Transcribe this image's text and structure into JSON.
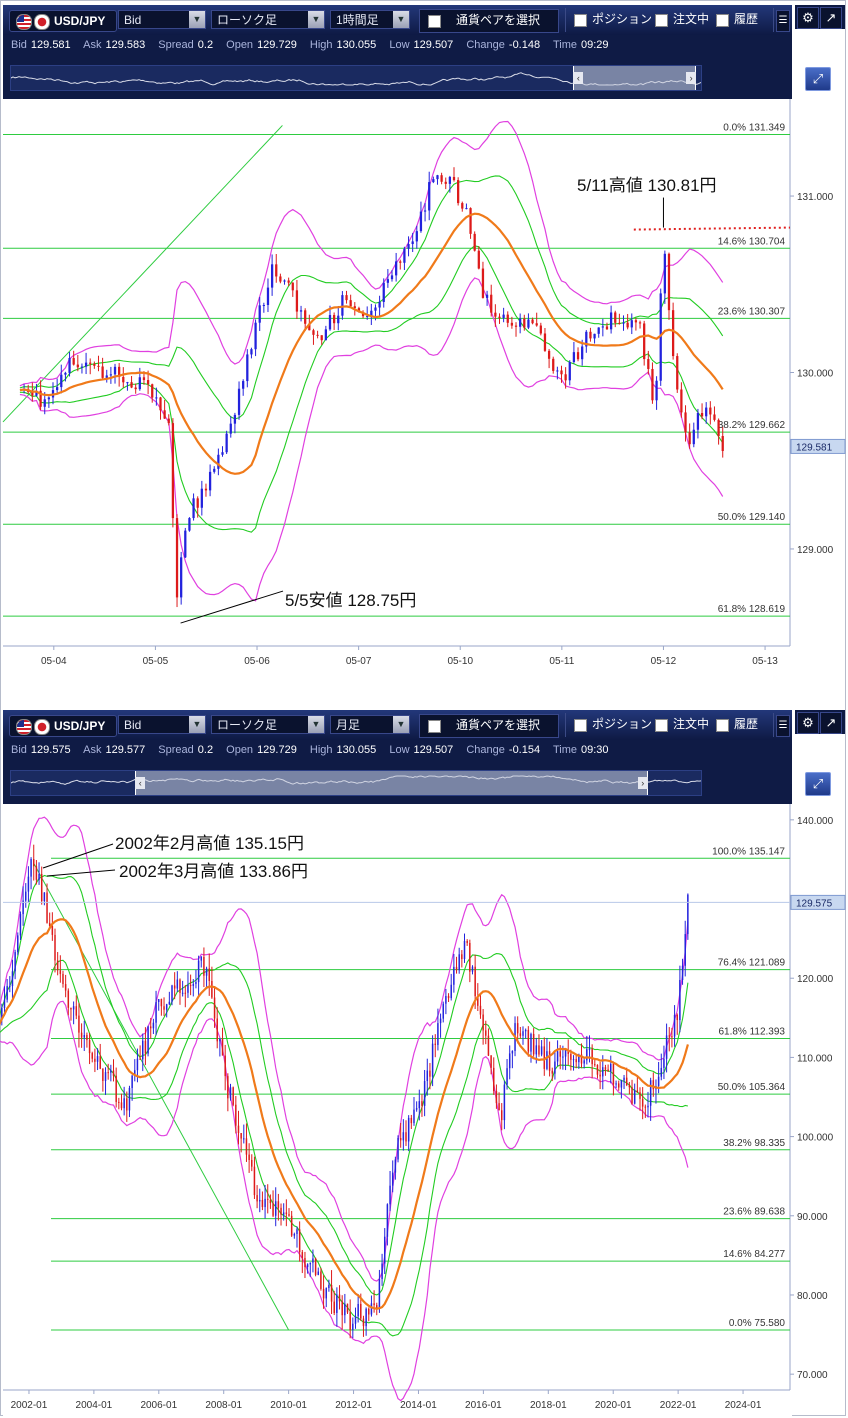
{
  "panels": [
    {
      "toolbar": {
        "pair": "USD/JPY",
        "price_type": "Bid",
        "chart_type": "ローソク足",
        "timeframe": "1時間足",
        "pair_select": "通貨ペアを選択",
        "position": "ポジション",
        "orders": "注文中",
        "history": "履歴"
      },
      "quote": {
        "bid_label": "Bid",
        "bid": "129.581",
        "ask_label": "Ask",
        "ask": "129.583",
        "spread_label": "Spread",
        "spread": "0.2",
        "open_label": "Open",
        "open": "129.729",
        "high_label": "High",
        "high": "130.055",
        "low_label": "Low",
        "low": "129.507",
        "change_label": "Change",
        "change": "-0.148",
        "time_label": "Time",
        "time": "09:29"
      },
      "navigator": {
        "selection_start": 0.815,
        "selection_end": 0.99
      },
      "annotations": [
        "5/11高値 130.81円",
        "5/5安値 128.75円"
      ],
      "current_price": "129.581",
      "fib_labels": [
        "0.0%  131.349",
        "14.6%  130.704",
        "23.6%  130.307",
        "38.2%  129.662",
        "50.0%  129.140",
        "61.8%  128.619"
      ],
      "y_ticks": [
        "131.000",
        "130.000",
        "129.000"
      ],
      "x_ticks": [
        "05-04",
        "05-05",
        "05-06",
        "05-07",
        "05-10",
        "05-11",
        "05-12",
        "05-13"
      ]
    },
    {
      "toolbar": {
        "pair": "USD/JPY",
        "price_type": "Bid",
        "chart_type": "ローソク足",
        "timeframe": "月足",
        "pair_select": "通貨ペアを選択",
        "position": "ポジション",
        "orders": "注文中",
        "history": "履歴"
      },
      "quote": {
        "bid_label": "Bid",
        "bid": "129.575",
        "ask_label": "Ask",
        "ask": "129.577",
        "spread_label": "Spread",
        "spread": "0.2",
        "open_label": "Open",
        "open": "129.729",
        "high_label": "High",
        "high": "130.055",
        "low_label": "Low",
        "low": "129.507",
        "change_label": "Change",
        "change": "-0.154",
        "time_label": "Time",
        "time": "09:30"
      },
      "navigator": {
        "selection_start": 0.18,
        "selection_end": 0.92
      },
      "annotations": [
        "2002年2月高値 135.15円",
        "2002年3月高値 133.86円"
      ],
      "current_price": "129.575",
      "fib_labels": [
        "100.0%  135.147",
        "76.4%  121.089",
        "61.8%  112.393",
        "50.0%  105.364",
        "38.2%  98.335",
        "23.6%  89.638",
        "14.6%  84.277",
        "0.0%  75.580"
      ],
      "y_ticks": [
        "140.000",
        "130.000",
        "120.000",
        "110.000",
        "100.000",
        "90.000",
        "80.000",
        "70.000"
      ],
      "x_ticks": [
        "2002-01",
        "2004-01",
        "2006-01",
        "2008-01",
        "2010-01",
        "2012-01",
        "2014-01",
        "2016-01",
        "2018-01",
        "2020-01",
        "2022-01",
        "2024-01"
      ]
    }
  ],
  "chart_data": [
    {
      "type": "candlestick",
      "symbol": "USD/JPY",
      "timeframe": "1時間足",
      "ylim": [
        128.45,
        131.55
      ],
      "fibonacci": [
        {
          "level": "0.0%",
          "price": 131.349
        },
        {
          "level": "14.6%",
          "price": 130.704
        },
        {
          "level": "23.6%",
          "price": 130.307
        },
        {
          "level": "38.2%",
          "price": 129.662
        },
        {
          "level": "50.0%",
          "price": 129.14
        },
        {
          "level": "61.8%",
          "price": 128.619
        }
      ],
      "close_path": [
        [
          0,
          129.95
        ],
        [
          6,
          129.82
        ],
        [
          12,
          130.05
        ],
        [
          20,
          130.0
        ],
        [
          28,
          129.95
        ],
        [
          35,
          129.75
        ],
        [
          37,
          128.75
        ],
        [
          40,
          129.2
        ],
        [
          44,
          129.35
        ],
        [
          48,
          129.6
        ],
        [
          52,
          129.9
        ],
        [
          56,
          130.3
        ],
        [
          60,
          130.6
        ],
        [
          64,
          130.45
        ],
        [
          70,
          130.15
        ],
        [
          76,
          130.4
        ],
        [
          82,
          130.3
        ],
        [
          88,
          130.55
        ],
        [
          94,
          130.8
        ],
        [
          98,
          131.15
        ],
        [
          102,
          131.1
        ],
        [
          106,
          130.85
        ],
        [
          110,
          130.4
        ],
        [
          116,
          130.3
        ],
        [
          122,
          130.25
        ],
        [
          128,
          129.95
        ],
        [
          134,
          130.2
        ],
        [
          140,
          130.3
        ],
        [
          146,
          130.3
        ],
        [
          150,
          129.8
        ],
        [
          152,
          130.75
        ],
        [
          154,
          130.1
        ],
        [
          158,
          129.6
        ],
        [
          162,
          129.85
        ],
        [
          166,
          129.58
        ]
      ],
      "marked_high": {
        "label": "5/11高値",
        "value": 130.81
      },
      "marked_low": {
        "label": "5/5安値",
        "value": 128.75
      },
      "last_price": 129.581
    },
    {
      "type": "candlestick",
      "symbol": "USD/JPY",
      "timeframe": "月足",
      "ylim": [
        68,
        142
      ],
      "fibonacci": [
        {
          "level": "100.0%",
          "price": 135.147
        },
        {
          "level": "76.4%",
          "price": 121.089
        },
        {
          "level": "61.8%",
          "price": 112.393
        },
        {
          "level": "50.0%",
          "price": 105.364
        },
        {
          "level": "38.2%",
          "price": 98.335
        },
        {
          "level": "23.6%",
          "price": 89.638
        },
        {
          "level": "14.6%",
          "price": 84.277
        },
        {
          "level": "0.0%",
          "price": 75.58
        }
      ],
      "close_path": [
        [
          2001.0,
          115
        ],
        [
          2001.5,
          121
        ],
        [
          2002.1,
          135
        ],
        [
          2002.3,
          133
        ],
        [
          2003.0,
          119
        ],
        [
          2004.0,
          110
        ],
        [
          2005.0,
          104
        ],
        [
          2006.0,
          117
        ],
        [
          2007.5,
          122
        ],
        [
          2008.0,
          108
        ],
        [
          2009.0,
          93
        ],
        [
          2010.0,
          89
        ],
        [
          2011.0,
          81
        ],
        [
          2011.8,
          77
        ],
        [
          2012.7,
          78
        ],
        [
          2013.3,
          99
        ],
        [
          2014.0,
          103
        ],
        [
          2015.0,
          120
        ],
        [
          2015.5,
          124
        ],
        [
          2016.5,
          102
        ],
        [
          2017.0,
          114
        ],
        [
          2018.0,
          109
        ],
        [
          2019.0,
          110
        ],
        [
          2020.0,
          108
        ],
        [
          2021.0,
          104
        ],
        [
          2021.8,
          114
        ],
        [
          2022.0,
          116
        ],
        [
          2022.3,
          129.5
        ]
      ],
      "marked_highs": [
        {
          "label": "2002年2月高値",
          "value": 135.15
        },
        {
          "label": "2002年3月高値",
          "value": 133.86
        }
      ],
      "last_price": 129.575
    }
  ]
}
